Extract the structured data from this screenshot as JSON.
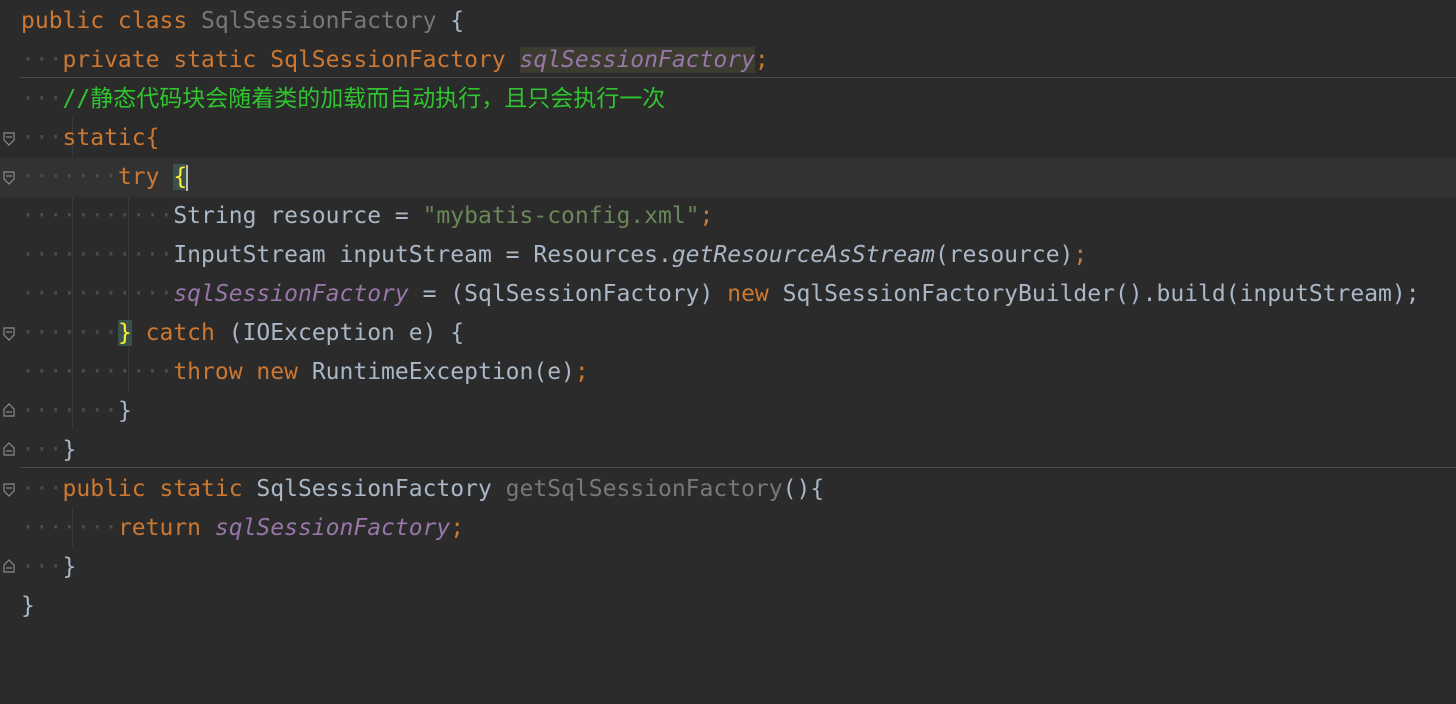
{
  "editor": {
    "lines": [
      [
        "public class ",
        "SqlSessionFactory",
        " {"
      ],
      [
        "private static SqlSessionFactory ",
        "sqlSessionFactory",
        ";"
      ],
      [
        "//静态代码块会随着类的加载而自动执行，且只会执行一次"
      ],
      [
        "static{"
      ],
      [
        "try ",
        "{"
      ],
      [
        "String resource = ",
        "\"mybatis-config.xml\"",
        ";"
      ],
      [
        "InputStream inputStream = Resources.",
        "getResourceAsStream",
        "(resource)",
        ";"
      ],
      [
        "sqlSessionFactory",
        " = (SqlSessionFactory) ",
        "new",
        " SqlSessionFactoryBuilder().build(inputStream);"
      ],
      [
        "}",
        " catch",
        " (IOException e) {"
      ],
      [
        "throw new ",
        "RuntimeException(e)",
        ";"
      ],
      [
        "}"
      ],
      [
        "}"
      ],
      [
        "public static ",
        "SqlSessionFactory ",
        "getSqlSessionFactory",
        "(){"
      ],
      [
        "return ",
        "sqlSessionFactory",
        ";"
      ],
      [
        "}"
      ],
      [
        "}"
      ]
    ]
  },
  "colors": {
    "background": "#2b2b2b",
    "keyword": "#cc7832",
    "field": "#9876aa",
    "string": "#6a8759",
    "comment": "#2ec52e",
    "text": "#a9b7c6"
  }
}
